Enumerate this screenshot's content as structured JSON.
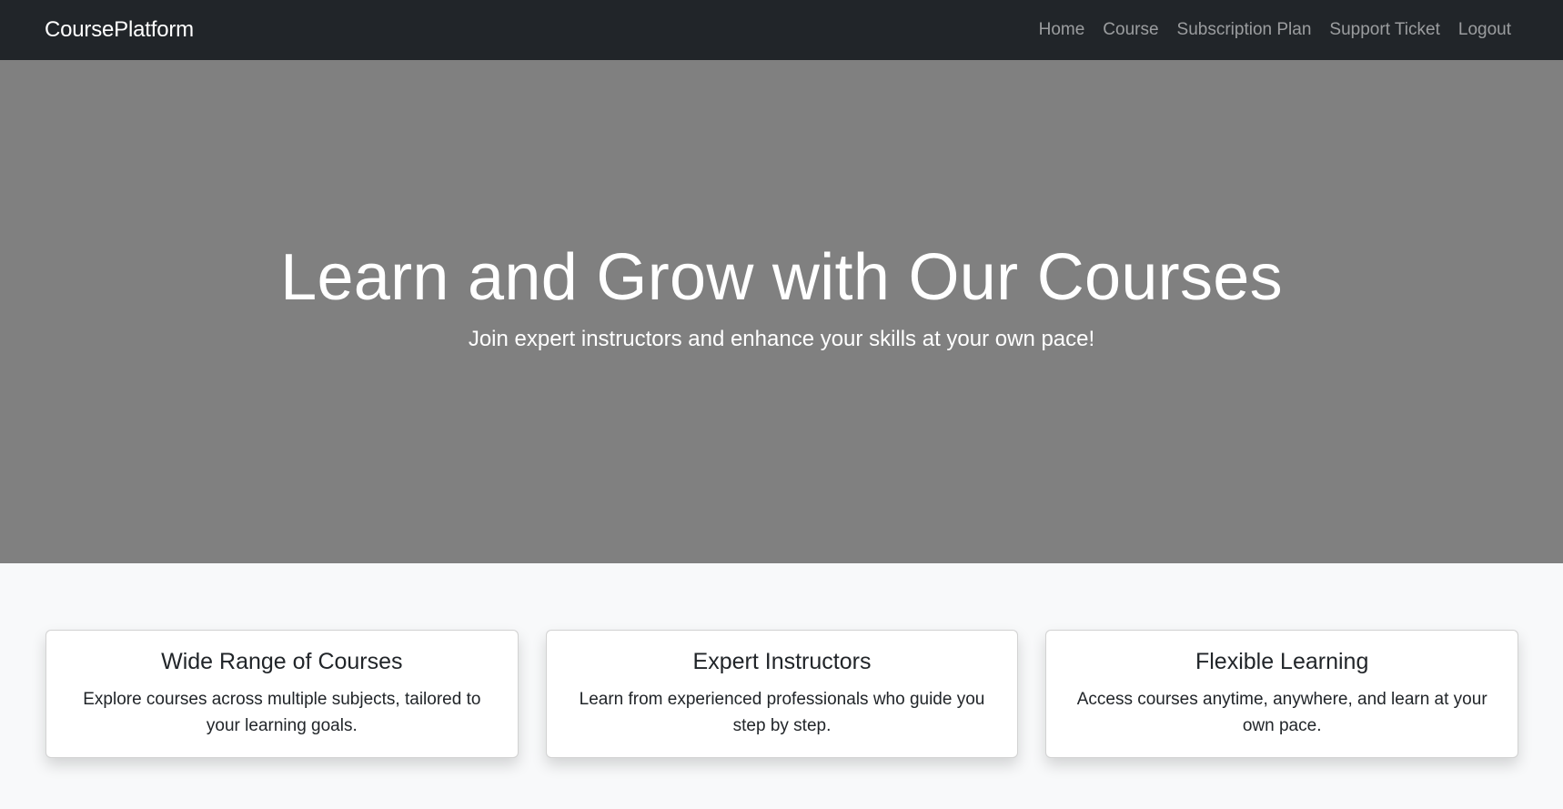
{
  "navbar": {
    "brand": "CoursePlatform",
    "links": [
      {
        "label": "Home"
      },
      {
        "label": "Course"
      },
      {
        "label": "Subscription Plan"
      },
      {
        "label": "Support Ticket"
      },
      {
        "label": "Logout"
      }
    ]
  },
  "hero": {
    "title": "Learn and Grow with Our Courses",
    "subtitle": "Join expert instructors and enhance your skills at your own pace!"
  },
  "features": [
    {
      "title": "Wide Range of Courses",
      "text": "Explore courses across multiple subjects, tailored to your learning goals."
    },
    {
      "title": "Expert Instructors",
      "text": "Learn from experienced professionals who guide you step by step."
    },
    {
      "title": "Flexible Learning",
      "text": "Access courses anytime, anywhere, and learn at your own pace."
    }
  ],
  "colors": {
    "navbar_bg": "#212529",
    "hero_bg": "#808080",
    "page_bg": "#f8f9fa"
  }
}
